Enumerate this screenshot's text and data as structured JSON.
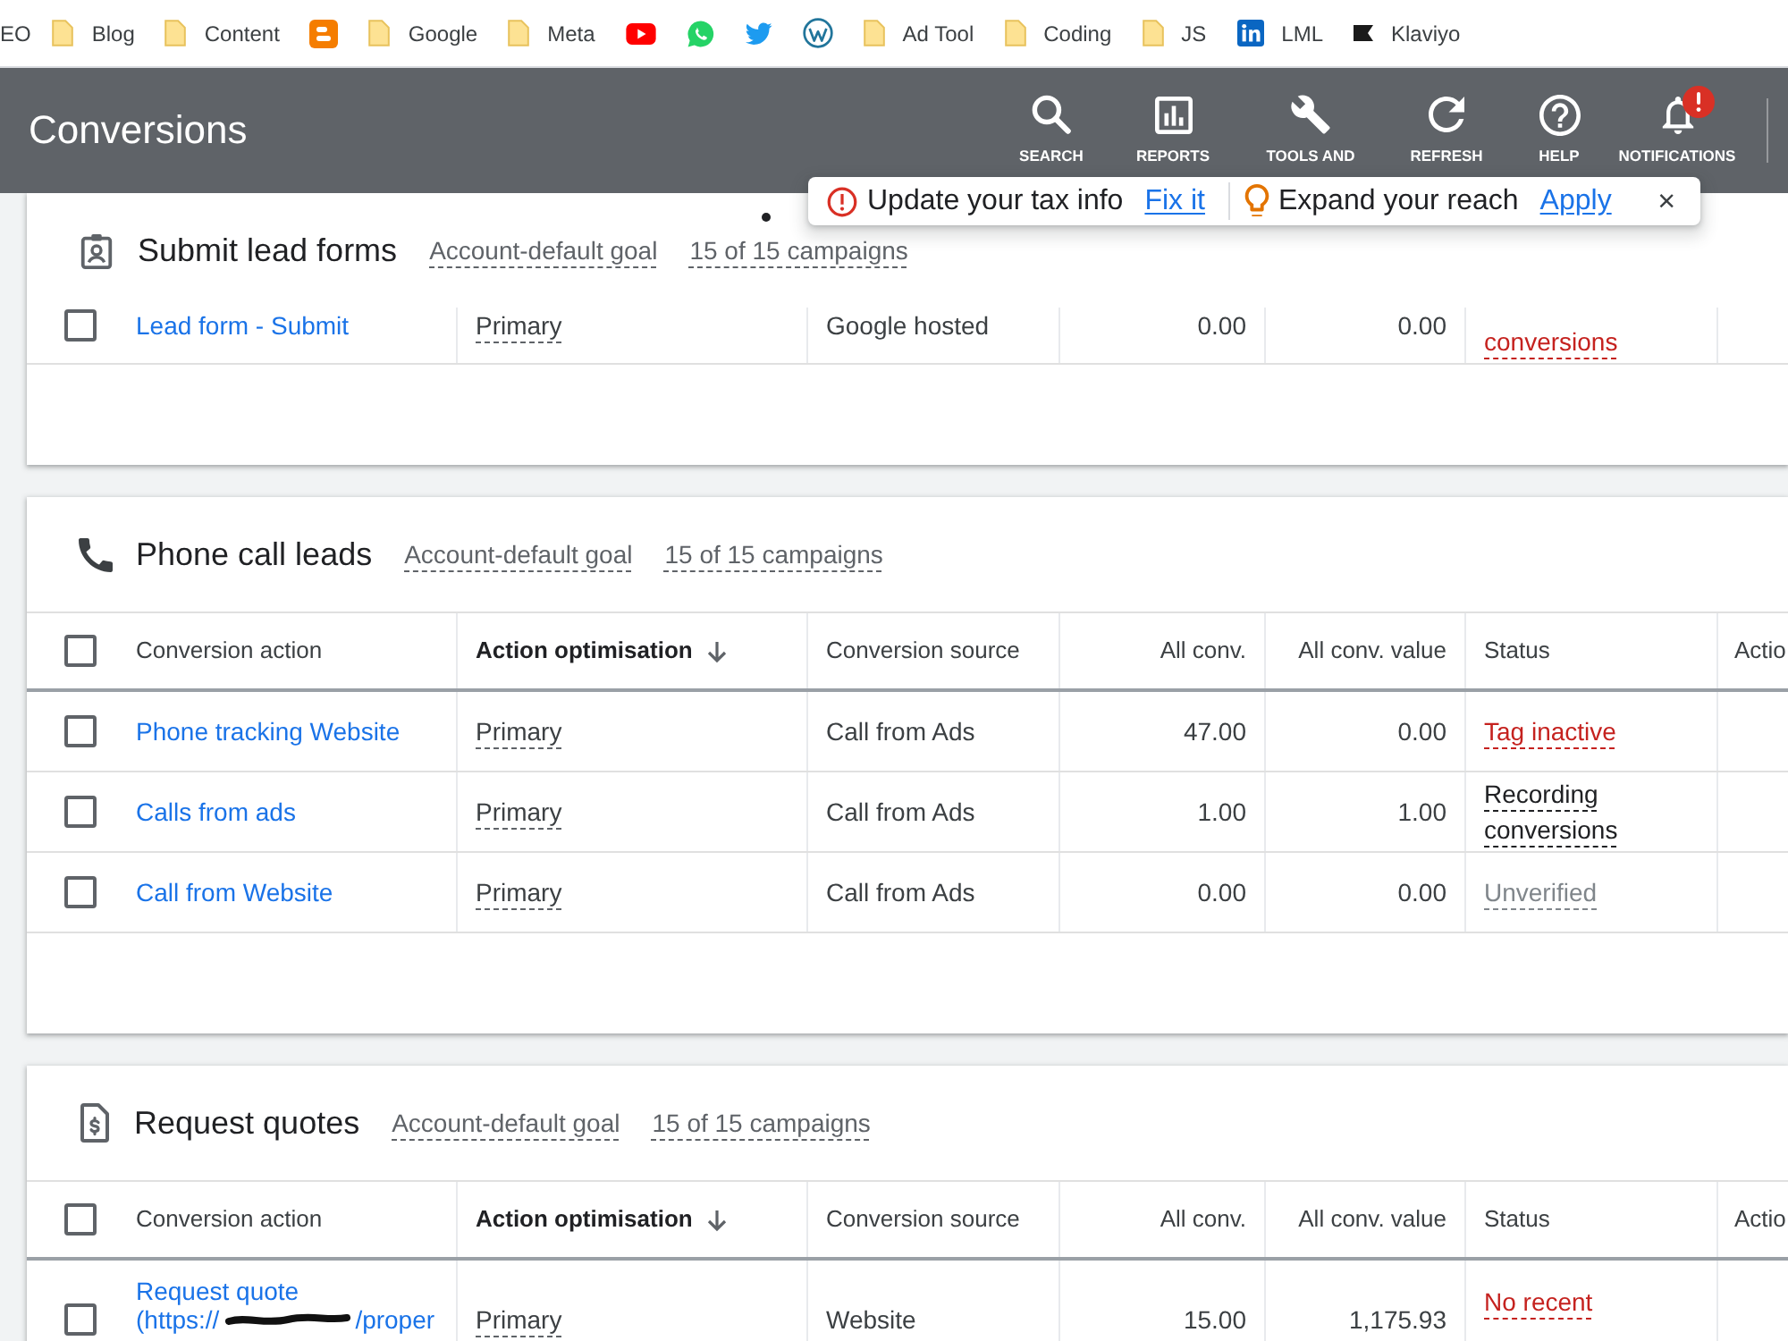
{
  "bookmarks": [
    {
      "kind": "text",
      "label": "EO"
    },
    {
      "kind": "folder",
      "label": "Blog"
    },
    {
      "kind": "folder",
      "label": "Content"
    },
    {
      "kind": "blog"
    },
    {
      "kind": "folder",
      "label": "Google"
    },
    {
      "kind": "folder",
      "label": "Meta"
    },
    {
      "kind": "video"
    },
    {
      "kind": "chat"
    },
    {
      "kind": "bird"
    },
    {
      "kind": "site"
    },
    {
      "kind": "folder",
      "label": "Ad Tool"
    },
    {
      "kind": "folder",
      "label": "Coding"
    },
    {
      "kind": "folder",
      "label": "JS"
    },
    {
      "kind": "network",
      "label": "LML"
    },
    {
      "kind": "flag",
      "label": "Klaviyo"
    }
  ],
  "header": {
    "title": "Conversions",
    "tools": [
      {
        "kind": "search",
        "label": "SEARCH",
        "alert": false
      },
      {
        "kind": "reports",
        "label": "REPORTS",
        "alert": false
      },
      {
        "kind": "tools",
        "label": "TOOLS AND",
        "alert": false
      },
      {
        "kind": "refresh",
        "label": "REFRESH",
        "alert": false
      },
      {
        "kind": "help",
        "label": "HELP",
        "alert": false
      },
      {
        "kind": "notifications",
        "label": "NOTIFICATIONS",
        "alert": true
      }
    ]
  },
  "notice_bar": {
    "items": [
      {
        "kind": "warning",
        "text": "Update your tax info",
        "link": "Fix it"
      },
      {
        "kind": "tip",
        "text": "Expand your reach",
        "link": "Apply"
      }
    ],
    "close": "×"
  },
  "sections": [
    {
      "kind": "form",
      "title": "Submit lead forms",
      "goal": "Account-default goal",
      "campaigns": "15 of 15 campaigns",
      "rows": [
        {
          "checked": false,
          "name": "Lead form - Submit",
          "optimisation": "Primary",
          "source": "Google hosted",
          "all_conv": "0.00",
          "all_conv_value": "0.00",
          "status": {
            "text": "conversions",
            "color": "#c5221f"
          }
        }
      ]
    },
    {
      "kind": "phone",
      "title": "Phone call leads",
      "goal": "Account-default goal",
      "campaigns": "15 of 15 campaigns",
      "all_checked": false,
      "columns": [
        {
          "label": "Conversion action",
          "sorted": false
        },
        {
          "label": "Action optimisation",
          "sorted": true
        },
        {
          "label": "Conversion source",
          "sorted": false
        },
        {
          "label": "All conv.",
          "sorted": false
        },
        {
          "label": "All conv. value",
          "sorted": false
        },
        {
          "label": "Status",
          "sorted": false
        },
        {
          "label": "Actio",
          "sorted": false
        }
      ],
      "rows": [
        {
          "checked": false,
          "name": "Phone tracking Website",
          "optimisation": "Primary",
          "source": "Call from Ads",
          "all_conv": "47.00",
          "all_conv_value": "0.00",
          "status": {
            "text": "Tag inactive",
            "color": "#c5221f"
          }
        },
        {
          "checked": false,
          "name": "Calls from ads",
          "optimisation": "Primary",
          "source": "Call from Ads",
          "all_conv": "1.00",
          "all_conv_value": "1.00",
          "status": {
            "text": "Recording conversions",
            "color": "#202124"
          }
        },
        {
          "checked": false,
          "name": "Call from Website",
          "optimisation": "Primary",
          "source": "Call from Ads",
          "all_conv": "0.00",
          "all_conv_value": "0.00",
          "status": {
            "text": "Unverified",
            "color": "#80868b"
          }
        }
      ]
    },
    {
      "kind": "quote",
      "title": "Request quotes",
      "goal": "Account-default goal",
      "campaigns": "15 of 15 campaigns",
      "all_checked": false,
      "columns": [
        {
          "label": "Conversion action",
          "sorted": false
        },
        {
          "label": "Action optimisation",
          "sorted": true
        },
        {
          "label": "Conversion source",
          "sorted": false
        },
        {
          "label": "All conv.",
          "sorted": false
        },
        {
          "label": "All conv. value",
          "sorted": false
        },
        {
          "label": "Status",
          "sorted": false
        },
        {
          "label": "Actio",
          "sorted": false
        }
      ],
      "rows": [
        {
          "checked": false,
          "name": "Request quote",
          "url_start": "(https://",
          "url_end": "/proper",
          "optimisation": "Primary",
          "source": "Website",
          "all_conv": "15.00",
          "all_conv_value": "1,175.93",
          "status": {
            "text": "No recent",
            "color": "#c5221f"
          }
        }
      ]
    }
  ]
}
